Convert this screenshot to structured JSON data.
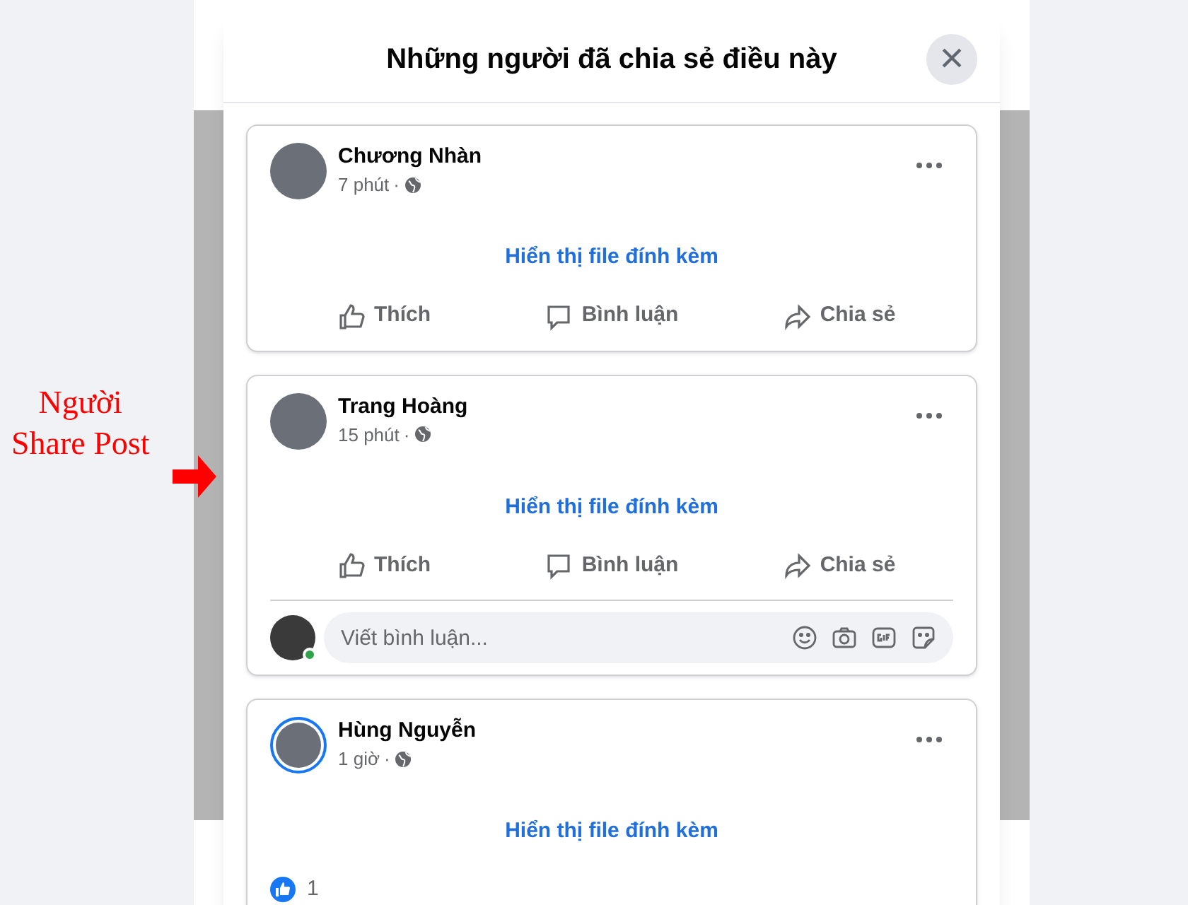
{
  "annotation": {
    "lines": [
      "Người",
      "Share Post"
    ]
  },
  "dialog": {
    "title": "Những người đã chia sẻ điều này",
    "close_label": "×"
  },
  "posts": [
    {
      "name": "Chương Nhàn",
      "time": "7 phút",
      "separator": "·",
      "story_ring": false,
      "attachment_link": "Hiển thị file đính kèm",
      "actions": [
        "Thích",
        "Bình luận",
        "Chia sẻ"
      ]
    },
    {
      "name": "Trang Hoàng",
      "time": "15 phút",
      "separator": "·",
      "story_ring": false,
      "attachment_link": "Hiển thị file đính kèm",
      "actions": [
        "Thích",
        "Bình luận",
        "Chia sẻ"
      ],
      "comment_box": {
        "placeholder": "Viết bình luận...",
        "online": true
      }
    },
    {
      "name": "Hùng Nguyễn",
      "time": "1 giờ",
      "separator": "·",
      "story_ring": true,
      "attachment_link": "Hiển thị file đính kèm",
      "reactions": {
        "count": "1"
      }
    }
  ]
}
